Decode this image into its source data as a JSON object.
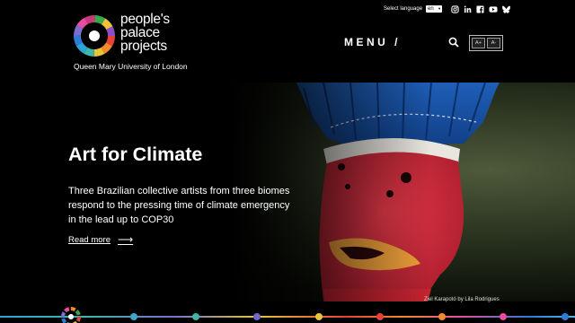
{
  "header": {
    "logo_lines": [
      "people's",
      "palace",
      "projects"
    ],
    "logo_sub": "Queen Mary University of London",
    "lang_label": "Select language",
    "lang_value": "en",
    "menu_label": "MENU /",
    "font_small": "A+",
    "font_large": "A-",
    "social": [
      "instagram-icon",
      "linkedin-icon",
      "facebook-icon",
      "youtube-icon",
      "bluesky-icon"
    ]
  },
  "hero": {
    "title": "Art for Climate",
    "text": "Three Brazilian collective artists from three biomes respond to the pressing time of climate emergency in the lead up to COP30",
    "read_more": "Read more",
    "arrow": "⟶",
    "caption": "Ziel Karapotó by Lila Rodrigues"
  },
  "colors": {
    "dots": [
      "#3aa9c9",
      "#3fb6a8",
      "#6f67c9",
      "#e7c63a",
      "#e6423b",
      "#f28a2a",
      "#e94da0",
      "#2e7bd6"
    ]
  }
}
